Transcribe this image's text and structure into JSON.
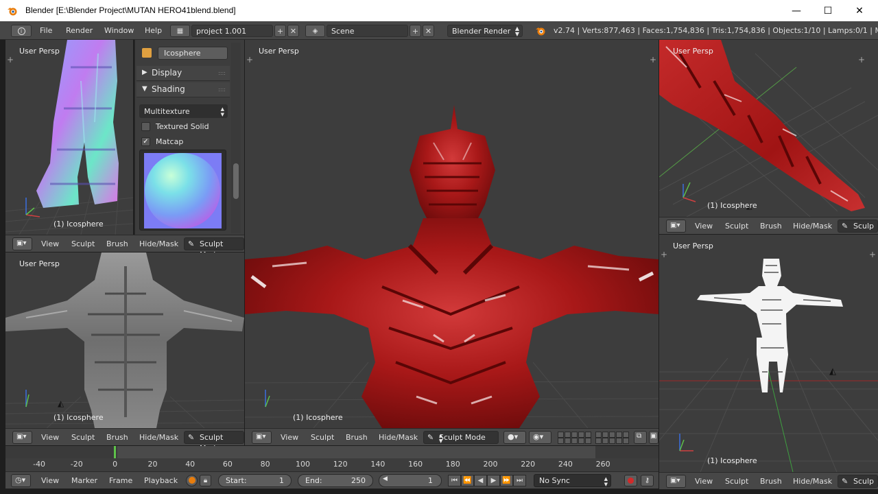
{
  "window": {
    "title": "Blender [E:\\Blender Project\\MUTAN HERO41blend.blend]",
    "minimize": "—",
    "maximize": "☐",
    "close": "✕"
  },
  "infobar": {
    "menu": [
      "File",
      "Render",
      "Window",
      "Help"
    ],
    "layout_name": "project 1.001",
    "scene_name": "Scene",
    "render_engine": "Blender Render",
    "stats": "v2.74 | Verts:877,463 | Faces:1,754,836 | Tris:1,754,836 | Objects:1/10 | Lamps:0/1 | Mem:"
  },
  "viewports": {
    "top_left": {
      "label": "User Persp",
      "object": "(1) Icosphere"
    },
    "bottom_left": {
      "label": "User Persp",
      "object": "(1) Icosphere"
    },
    "center": {
      "label": "User Persp",
      "object": "(1) Icosphere"
    },
    "top_right": {
      "label": "User Persp",
      "object": "(1) Icosphere"
    },
    "bottom_right": {
      "label": "User Persp",
      "object": "(1) Icosphere"
    }
  },
  "viewport_header": {
    "view": "View",
    "sculpt": "Sculpt",
    "brush": "Brush",
    "hide_mask": "Hide/Mask",
    "mode": "Sculpt Mode",
    "mode_short": "Sculp"
  },
  "properties": {
    "object_name": "Icosphere",
    "display_panel": "Display",
    "shading_panel": "Shading",
    "shading_mode": "Multitexture",
    "textured_solid": "Textured Solid",
    "textured_solid_checked": false,
    "matcap": "Matcap",
    "matcap_checked": true
  },
  "timeline": {
    "ticks": [
      "-40",
      "-20",
      "0",
      "20",
      "40",
      "60",
      "80",
      "100",
      "120",
      "140",
      "160",
      "180",
      "200",
      "220",
      "240",
      "260"
    ],
    "current_frame_marker": 0
  },
  "timeline_header": {
    "view": "View",
    "marker": "Marker",
    "frame": "Frame",
    "playback": "Playback",
    "start_label": "Start:",
    "start_value": "1",
    "end_label": "End:",
    "end_value": "250",
    "current_frame": "1",
    "sync": "No Sync"
  },
  "colors": {
    "accent_blender": "#e87d0d",
    "timeline_playhead": "#5ec24a",
    "model_red": "#b51a1a"
  }
}
